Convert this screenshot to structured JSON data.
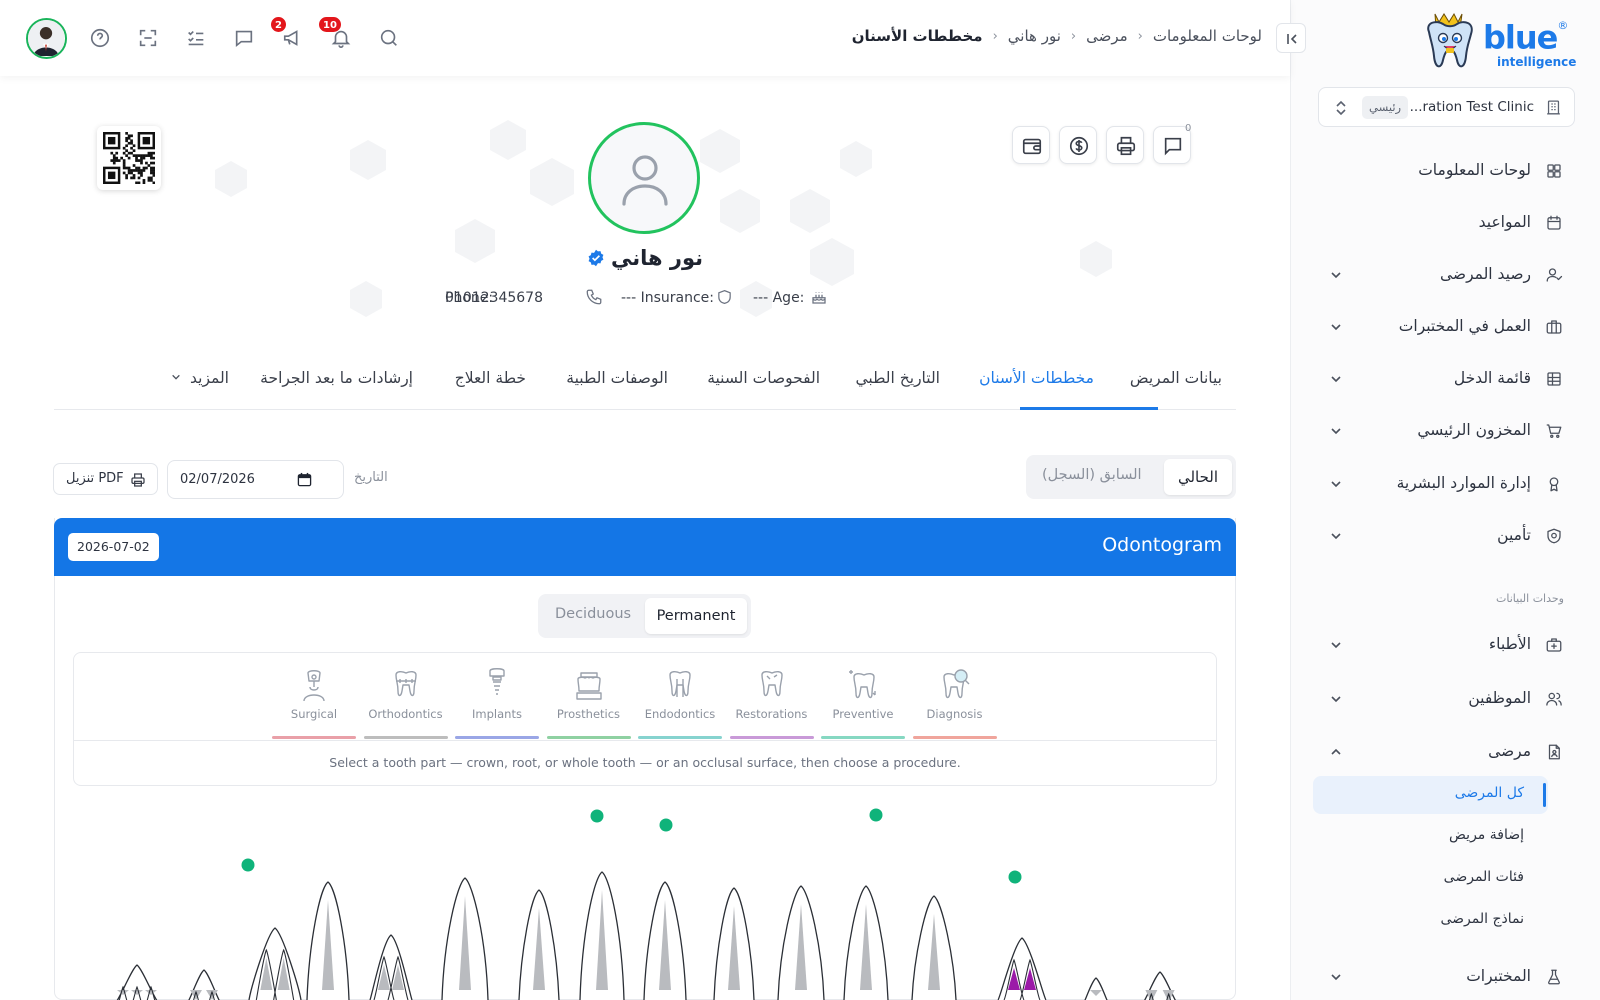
{
  "brand": {
    "name": "blue",
    "tagline": "intelligence",
    "colors": {
      "primary": "#1d7ae8",
      "header": "#1476e6",
      "accent_green": "#22c35e",
      "danger": "#e3161b",
      "marker": "#0fb37a",
      "highlight_root": "#9b1aa8"
    }
  },
  "clinic": {
    "name": "...ration Test Clinic",
    "badge": "رئيسي"
  },
  "sidebar": {
    "items": [
      {
        "label": "لوحات المعلومات",
        "icon": "grid-icon",
        "expandable": false
      },
      {
        "label": "المواعيد",
        "icon": "calendar-icon",
        "expandable": false
      },
      {
        "label": "رصيد المرضى",
        "icon": "user-balance-icon",
        "expandable": true
      },
      {
        "label": "العمل في المختبرات",
        "icon": "briefcase-icon",
        "expandable": true
      },
      {
        "label": "قائمة الدخل",
        "icon": "table-icon",
        "expandable": true
      },
      {
        "label": "المخزون الرئيسي",
        "icon": "cart-icon",
        "expandable": true
      },
      {
        "label": "إدارة الموارد البشرية",
        "icon": "award-icon",
        "expandable": true
      },
      {
        "label": "تأمين",
        "icon": "shield-icon",
        "expandable": true
      }
    ],
    "section_label": "وحدات البيانات",
    "data_items": [
      {
        "label": "الأطباء",
        "icon": "medical-bag-icon"
      },
      {
        "label": "الموظفين",
        "icon": "users-icon"
      },
      {
        "label": "مرضى",
        "icon": "patient-file-icon"
      }
    ],
    "patients_sub": [
      {
        "label": "كل المرضى",
        "active": true
      },
      {
        "label": "إضافة مريض",
        "active": false
      },
      {
        "label": "فئات المرضى",
        "active": false
      },
      {
        "label": "نماذج المرضى",
        "active": false
      }
    ],
    "bottom_item": {
      "label": "المختبرات",
      "icon": "flask-icon"
    }
  },
  "topbar": {
    "breadcrumb": [
      "لوحات المعلومات",
      "مرضى",
      "نور هاني",
      "مخططات الأسنان"
    ],
    "notifications_count": "10",
    "announcements_count": "2"
  },
  "patient": {
    "name": "نور هاني",
    "age_label": "Age:",
    "age_value": "---",
    "insurance_label": "Insurance:",
    "insurance_value": "---",
    "phone_label": "Phone:",
    "phone_value": "01012345678",
    "messages_count": "0"
  },
  "tabs": [
    {
      "label": "بيانات المريض",
      "active": false
    },
    {
      "label": "مخططات الأسنان",
      "active": true
    },
    {
      "label": "التاريخ الطبي",
      "active": false
    },
    {
      "label": "الفحوصات السنية",
      "active": false
    },
    {
      "label": "الوصفات الطبية",
      "active": false
    },
    {
      "label": "خطة العلاج",
      "active": false
    },
    {
      "label": "إرشادات ما بعد الجراحة",
      "active": false
    },
    {
      "label": "المزيد",
      "active": false
    }
  ],
  "chart_view": {
    "current_label": "الحالي",
    "previous_label": "السابق (السجل)",
    "date_label": "التاريخ",
    "date_value": "2026-07-02",
    "date_display": "02/07/2026",
    "download_label": "تنزيل PDF"
  },
  "odontogram": {
    "title": "Odontogram",
    "date": "2026-07-02",
    "dentition": {
      "permanent": "Permanent",
      "deciduous": "Deciduous",
      "selected": "Permanent"
    },
    "procedures": [
      {
        "label": "Surgical",
        "icon": "surgical-icon",
        "color": "#e9a0a8"
      },
      {
        "label": "Orthodontics",
        "icon": "orthodontics-icon",
        "color": "#bdbdbd"
      },
      {
        "label": "Implants",
        "icon": "implant-icon",
        "color": "#9aa6e6"
      },
      {
        "label": "Prosthetics",
        "icon": "prosthetics-icon",
        "color": "#8fd1a2"
      },
      {
        "label": "Endodontics",
        "icon": "endodontics-icon",
        "color": "#86d3cf"
      },
      {
        "label": "Restorations",
        "icon": "restorations-icon",
        "color": "#c99ad8"
      },
      {
        "label": "Preventive",
        "icon": "preventive-icon",
        "color": "#86d8c2"
      },
      {
        "label": "Diagnosis",
        "icon": "diagnosis-icon",
        "color": "#f0a59c"
      }
    ],
    "hint": "Select a tooth part — crown, root, or whole tooth — or an occlusal surface, then choose a procedure."
  }
}
